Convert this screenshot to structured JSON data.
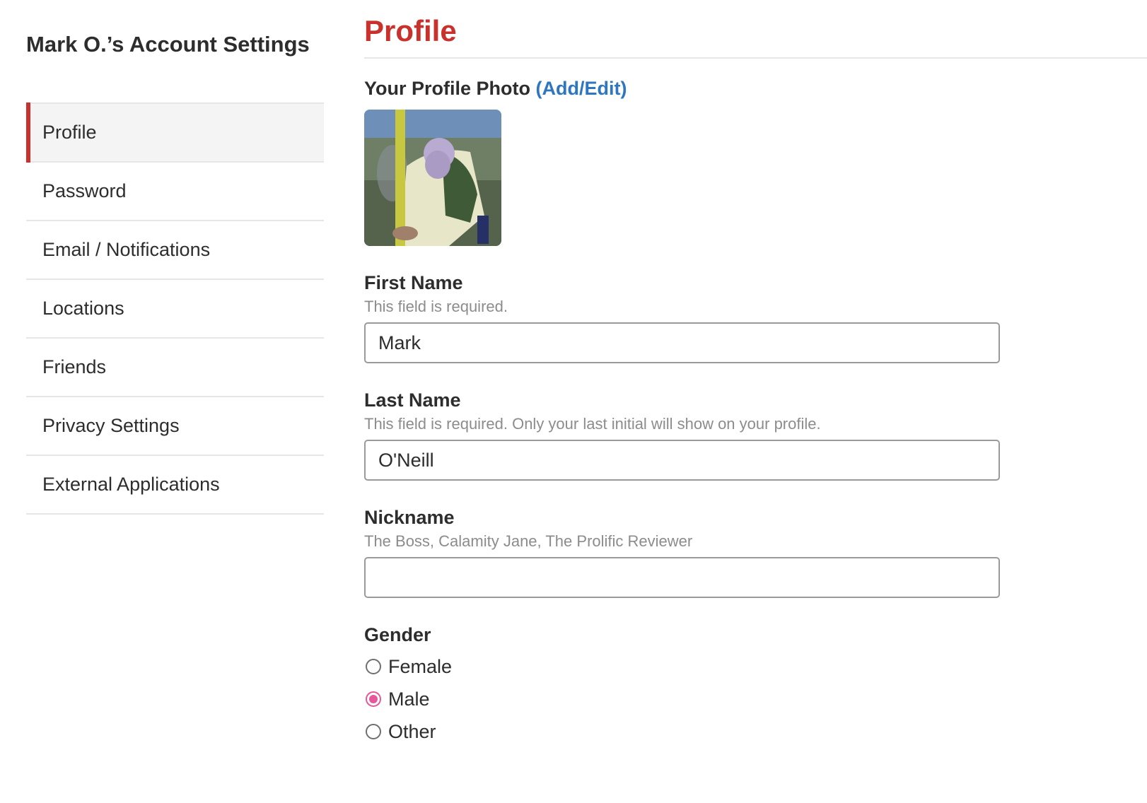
{
  "sidebar": {
    "title": "Mark O.’s Account Settings",
    "items": [
      {
        "label": "Profile",
        "active": true
      },
      {
        "label": "Password",
        "active": false
      },
      {
        "label": "Email / Notifications",
        "active": false
      },
      {
        "label": "Locations",
        "active": false
      },
      {
        "label": "Friends",
        "active": false
      },
      {
        "label": "Privacy Settings",
        "active": false
      },
      {
        "label": "External Applications",
        "active": false
      }
    ]
  },
  "main": {
    "title": "Profile",
    "photo": {
      "heading": "Your Profile Photo",
      "link_label": "(Add/Edit)"
    },
    "fields": {
      "first_name": {
        "label": "First Name",
        "hint": "This field is required.",
        "value": "Mark"
      },
      "last_name": {
        "label": "Last Name",
        "hint": "This field is required. Only your last initial will show on your profile.",
        "value": "O'Neill"
      },
      "nickname": {
        "label": "Nickname",
        "hint": "The Boss, Calamity Jane, The Prolific Reviewer",
        "value": ""
      }
    },
    "gender": {
      "label": "Gender",
      "options": [
        "Female",
        "Male",
        "Other"
      ],
      "selected": "Male"
    }
  },
  "colors": {
    "accent": "#c8312c",
    "link": "#2e76bf",
    "radio_selected": "#e5589c"
  }
}
